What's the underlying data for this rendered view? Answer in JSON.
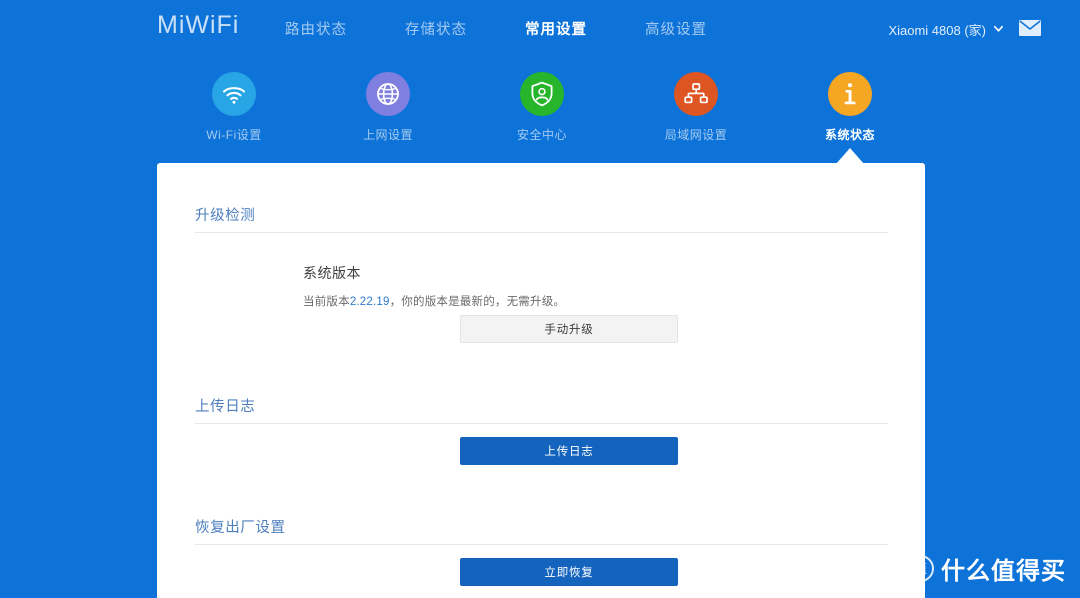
{
  "brand": {
    "logo_text": "MiWiFi"
  },
  "nav": {
    "items": [
      {
        "label": "路由状态",
        "active": false
      },
      {
        "label": "存储状态",
        "active": false
      },
      {
        "label": "常用设置",
        "active": true
      },
      {
        "label": "高级设置",
        "active": false
      }
    ],
    "account_label": "Xiaomi 4808 (家)",
    "chevron_icon": "chevron-down-icon",
    "mail_icon": "mail-icon"
  },
  "shortcuts": [
    {
      "label": "Wi-Fi设置",
      "icon": "wifi-icon",
      "color": "#27a5e5",
      "active": false
    },
    {
      "label": "上网设置",
      "icon": "globe-icon",
      "color": "#7f7fe0",
      "active": false
    },
    {
      "label": "安全中心",
      "icon": "shield-user-icon",
      "color": "#27b52c",
      "active": false
    },
    {
      "label": "局域网设置",
      "icon": "network-icon",
      "color": "#dd5522",
      "active": false
    },
    {
      "label": "系统状态",
      "icon": "info-icon",
      "color": "#f5a623",
      "active": true
    }
  ],
  "content": {
    "sections": [
      {
        "title": "升级检测",
        "sub_title": "系统版本",
        "version_prefix": "当前版本",
        "version_number": "2.22.19",
        "version_suffix": "，你的版本是最新的，无需升级。",
        "button_label": "手动升级",
        "button_style": "gray"
      },
      {
        "title": "上传日志",
        "button_label": "上传日志",
        "button_style": "blue"
      },
      {
        "title": "恢复出厂设置",
        "button_label": "立即恢复",
        "button_style": "blue"
      }
    ]
  },
  "watermark": {
    "badge_text": "值",
    "text": "什么值得买"
  },
  "colors": {
    "page_background": "#0d73d9",
    "panel_background": "#ffffff",
    "section_title": "#4d7fbe",
    "primary_button": "#1464bd",
    "link_blue": "#2f7ad1"
  }
}
